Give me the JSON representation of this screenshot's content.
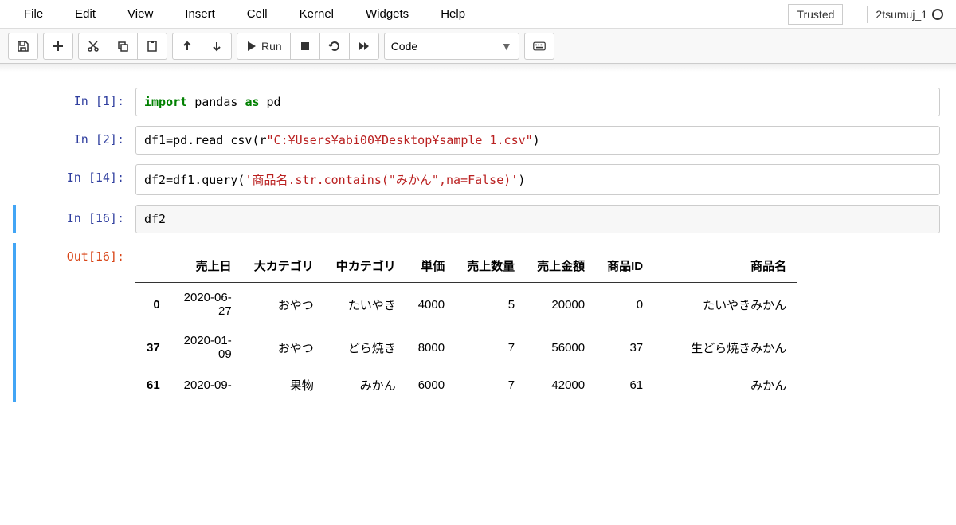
{
  "menu": {
    "file": "File",
    "edit": "Edit",
    "view": "View",
    "insert": "Insert",
    "cell": "Cell",
    "kernel": "Kernel",
    "widgets": "Widgets",
    "help": "Help"
  },
  "trusted": "Trusted",
  "kernel_name": "2tsumuj_1",
  "toolbar": {
    "run_label": "Run",
    "celltype": "Code"
  },
  "cells": [
    {
      "in_prompt": "In [1]:",
      "code_tokens": [
        {
          "t": "import",
          "c": "kw-green"
        },
        {
          "t": " pandas ",
          "c": ""
        },
        {
          "t": "as",
          "c": "kw-green"
        },
        {
          "t": " pd",
          "c": ""
        }
      ]
    },
    {
      "in_prompt": "In [2]:",
      "code_tokens": [
        {
          "t": "df1",
          "c": ""
        },
        {
          "t": "=",
          "c": ""
        },
        {
          "t": "pd.read_csv(",
          "c": ""
        },
        {
          "t": "r",
          "c": ""
        },
        {
          "t": "\"C:¥Users¥abi00¥Desktop¥sample_1.csv\"",
          "c": "str-red"
        },
        {
          "t": ")",
          "c": ""
        }
      ]
    },
    {
      "in_prompt": "In [14]:",
      "code_tokens": [
        {
          "t": "df2",
          "c": ""
        },
        {
          "t": "=",
          "c": ""
        },
        {
          "t": "df1.query(",
          "c": ""
        },
        {
          "t": "'商品名.str.contains(\"みかん\",na=False)'",
          "c": "str-red"
        },
        {
          "t": ")",
          "c": ""
        }
      ]
    },
    {
      "in_prompt": "In [16]:",
      "out_prompt": "Out[16]:",
      "code_tokens": [
        {
          "t": "df2",
          "c": ""
        }
      ],
      "df": {
        "columns": [
          "",
          "売上日",
          "大カテゴリ",
          "中カテゴリ",
          "単価",
          "売上数量",
          "売上金額",
          "商品ID",
          "商品名"
        ],
        "rows": [
          [
            "0",
            "2020-06-27",
            "おやつ",
            "たいやき",
            "4000",
            "5",
            "20000",
            "0",
            "たいやきみかん"
          ],
          [
            "37",
            "2020-01-09",
            "おやつ",
            "どら焼き",
            "8000",
            "7",
            "56000",
            "37",
            "生どら焼きみかん"
          ],
          [
            "61",
            "2020-09-",
            "果物",
            "みかん",
            "6000",
            "7",
            "42000",
            "61",
            "みかん"
          ]
        ]
      }
    }
  ]
}
